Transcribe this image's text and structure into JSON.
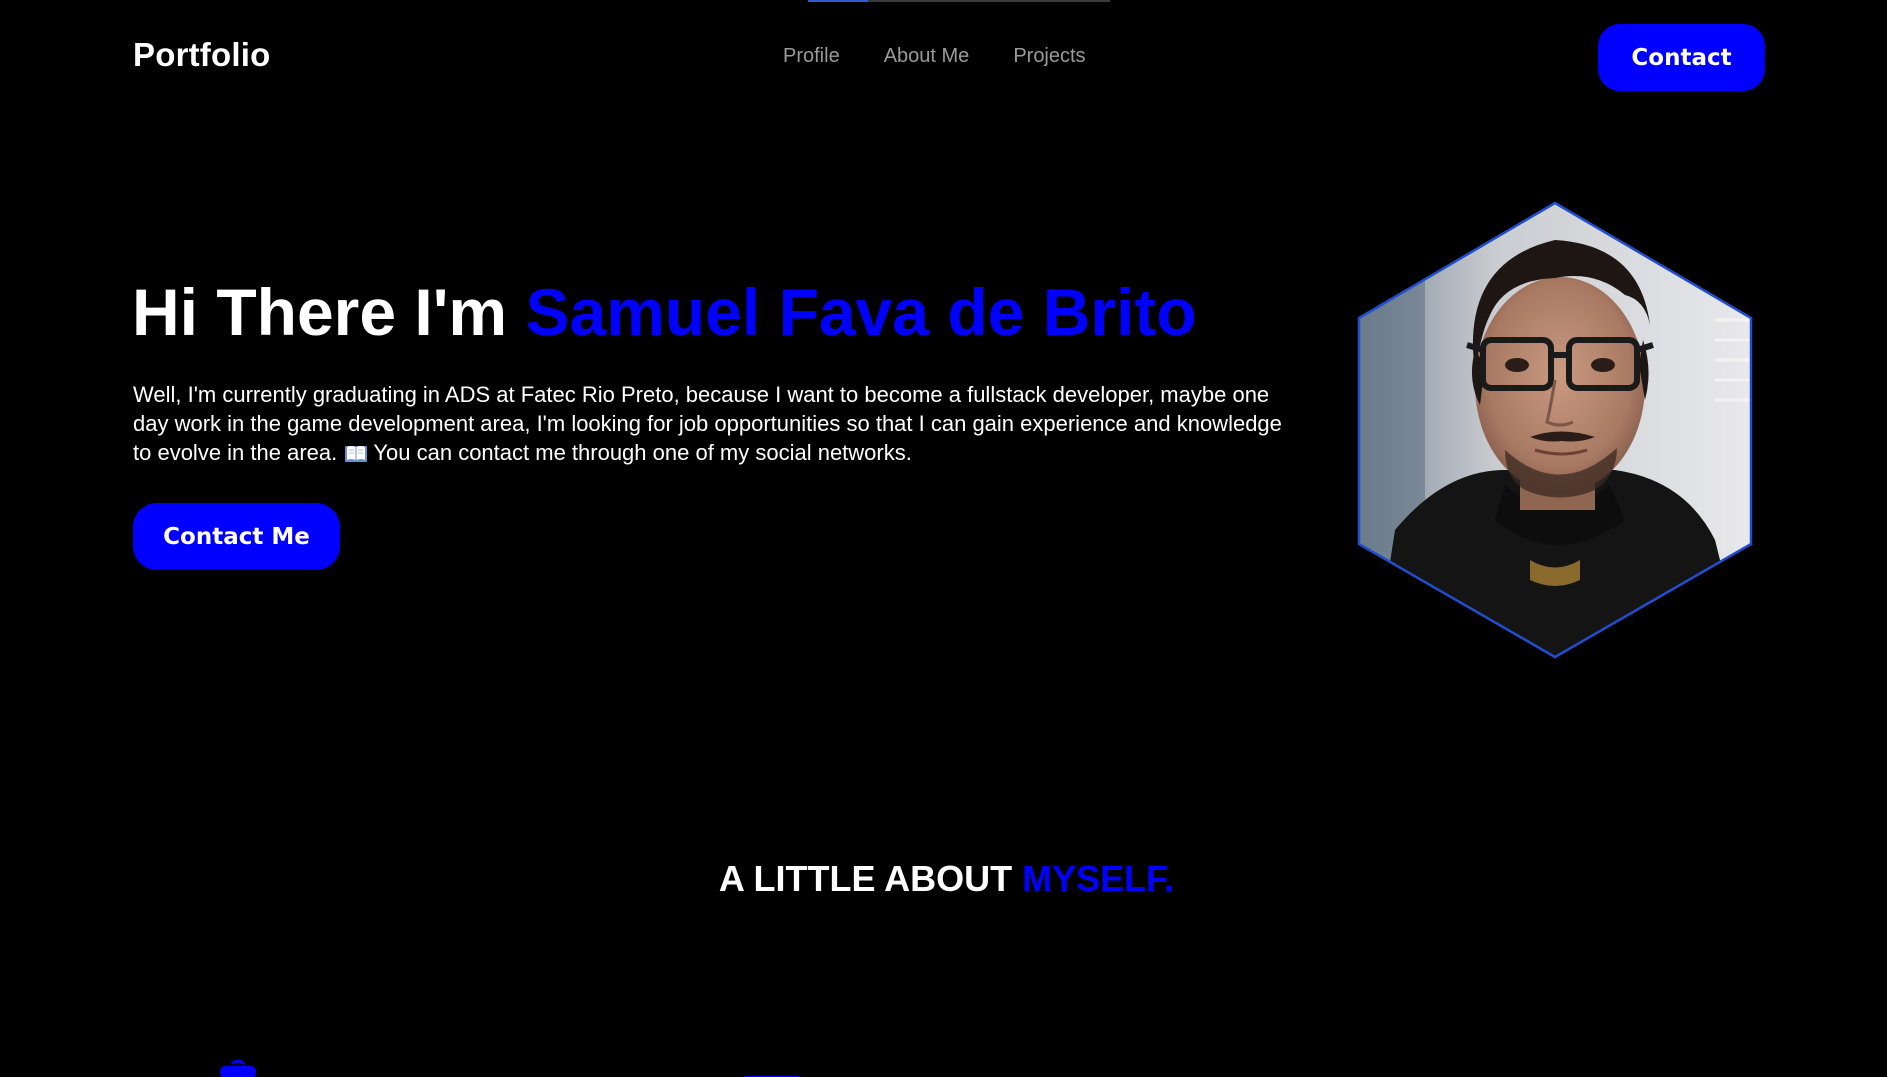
{
  "header": {
    "logo": "Portfolio",
    "nav": [
      {
        "label": "Profile"
      },
      {
        "label": "About Me"
      },
      {
        "label": "Projects"
      }
    ],
    "contact_label": "Contact"
  },
  "hero": {
    "greeting": "Hi There I'm ",
    "name": "Samuel Fava de Brito",
    "description_before_icon": "Well, I'm currently graduating in ADS at Fatec Rio Preto, because I want to become a fullstack developer, maybe one day work in the game development area, I'm looking for job opportunities so that I can gain experience and knowledge to evolve in the area.",
    "description_after_icon": "You can contact me through one of my social networks.",
    "inline_icon": "open-book-icon",
    "cta_label": "Contact Me",
    "avatar_icon": "profile-photo"
  },
  "about": {
    "title_white": "A LITTLE ABOUT ",
    "title_accent": "MYSELF."
  },
  "colors": {
    "background": "#000000",
    "accent": "#0000ff",
    "nav_text": "#9a9a9a",
    "hexagon_border": "#1f4fd0"
  }
}
